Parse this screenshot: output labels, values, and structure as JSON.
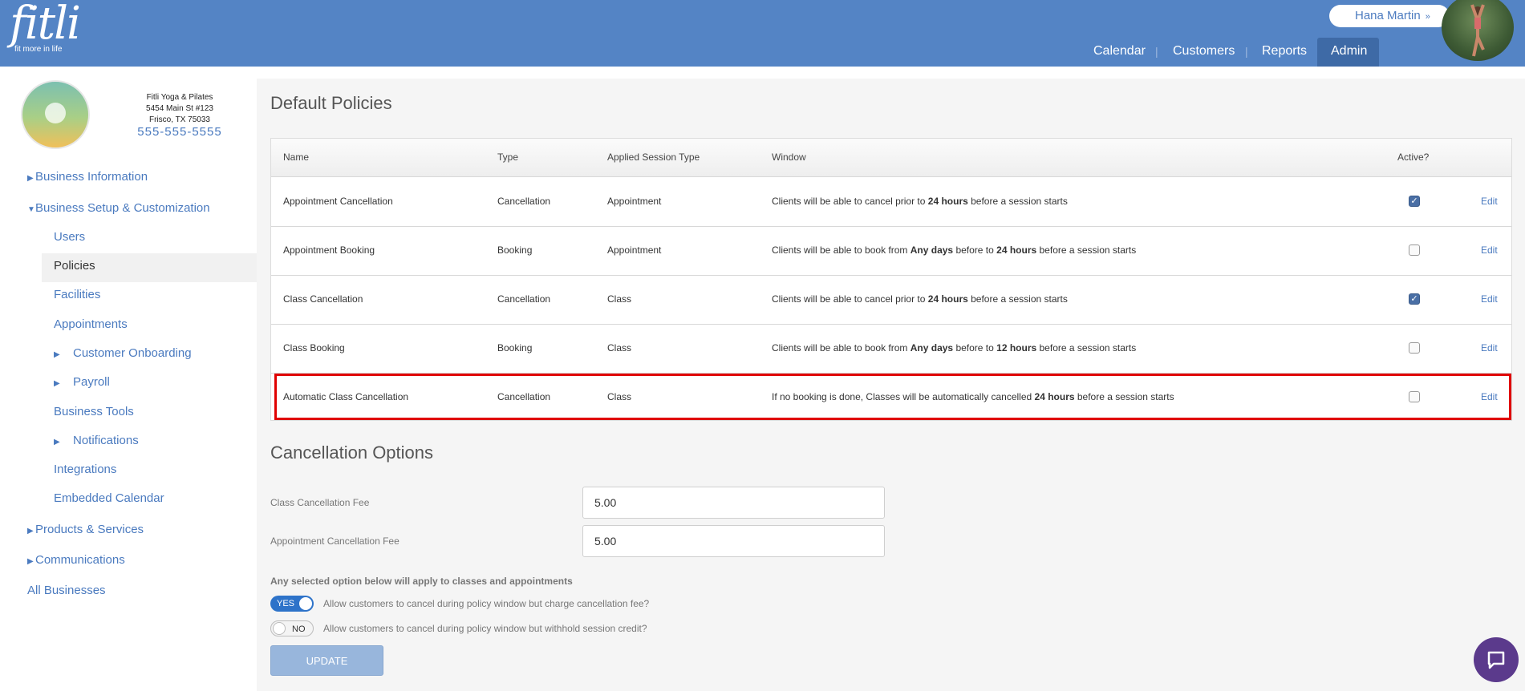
{
  "header": {
    "logo_text": "fitli",
    "logo_tagline": "fit more in life",
    "user_name": "Hana Martin",
    "user_chevron": "»",
    "nav": [
      {
        "label": "Calendar"
      },
      {
        "label": "Customers"
      },
      {
        "label": "Reports"
      },
      {
        "label": "Admin"
      }
    ],
    "nav_separator": "|"
  },
  "sidebar": {
    "business_name": "Fitli Yoga & Pilates",
    "address_line1": "5454 Main St #123",
    "address_line2": "Frisco, TX 75033",
    "phone": "555-555-5555",
    "items": [
      {
        "label": "Business Information"
      },
      {
        "label": "Business Setup & Customization"
      },
      {
        "label": "Users"
      },
      {
        "label": "Policies"
      },
      {
        "label": "Facilities"
      },
      {
        "label": "Appointments"
      },
      {
        "label": "Customer Onboarding"
      },
      {
        "label": "Payroll"
      },
      {
        "label": "Business Tools"
      },
      {
        "label": "Notifications"
      },
      {
        "label": "Integrations"
      },
      {
        "label": "Embedded Calendar"
      },
      {
        "label": "Products & Services"
      },
      {
        "label": "Communications"
      },
      {
        "label": "All Businesses"
      }
    ]
  },
  "policies": {
    "title": "Default Policies",
    "columns": {
      "name": "Name",
      "type": "Type",
      "session_type": "Applied Session Type",
      "window": "Window",
      "active": "Active?"
    },
    "edit_label": "Edit",
    "rows": [
      {
        "name": "Appointment Cancellation",
        "type": "Cancellation",
        "session_type": "Appointment",
        "w_pre": "Clients will be able to cancel prior to ",
        "w_b1": "24 hours",
        "w_mid": "",
        "w_b2": "",
        "w_post": " before a session starts",
        "active": true
      },
      {
        "name": "Appointment Booking",
        "type": "Booking",
        "session_type": "Appointment",
        "w_pre": "Clients will be able to book from ",
        "w_b1": "Any days",
        "w_mid": " before to ",
        "w_b2": "24 hours",
        "w_post": " before a session starts",
        "active": false
      },
      {
        "name": "Class Cancellation",
        "type": "Cancellation",
        "session_type": "Class",
        "w_pre": "Clients will be able to cancel prior to ",
        "w_b1": "24 hours",
        "w_mid": "",
        "w_b2": "",
        "w_post": " before a session starts",
        "active": true
      },
      {
        "name": "Class Booking",
        "type": "Booking",
        "session_type": "Class",
        "w_pre": "Clients will be able to book from ",
        "w_b1": "Any days",
        "w_mid": " before to ",
        "w_b2": "12 hours",
        "w_post": " before a session starts",
        "active": false
      },
      {
        "name": "Automatic Class Cancellation",
        "type": "Cancellation",
        "session_type": "Class",
        "w_pre": "If no booking is done, Classes will be automatically cancelled ",
        "w_b1": "24 hours",
        "w_mid": "",
        "w_b2": "",
        "w_post": " before a session starts",
        "active": false
      }
    ]
  },
  "cancellation": {
    "title": "Cancellation Options",
    "class_fee_label": "Class Cancellation Fee",
    "class_fee_value": "5.00",
    "appt_fee_label": "Appointment Cancellation Fee",
    "appt_fee_value": "5.00",
    "note": "Any selected option below will apply to classes and appointments",
    "option1_state": "YES",
    "option1_label": "Allow customers to cancel during policy window but charge cancellation fee?",
    "option2_state": "NO",
    "option2_label": "Allow customers to cancel during policy window but withhold session credit?",
    "update_label": "UPDATE"
  },
  "colors": {
    "header_bg": "#5484c5",
    "link": "#4a7abf",
    "highlight": "#e00000",
    "chat": "#5b3a8c"
  }
}
